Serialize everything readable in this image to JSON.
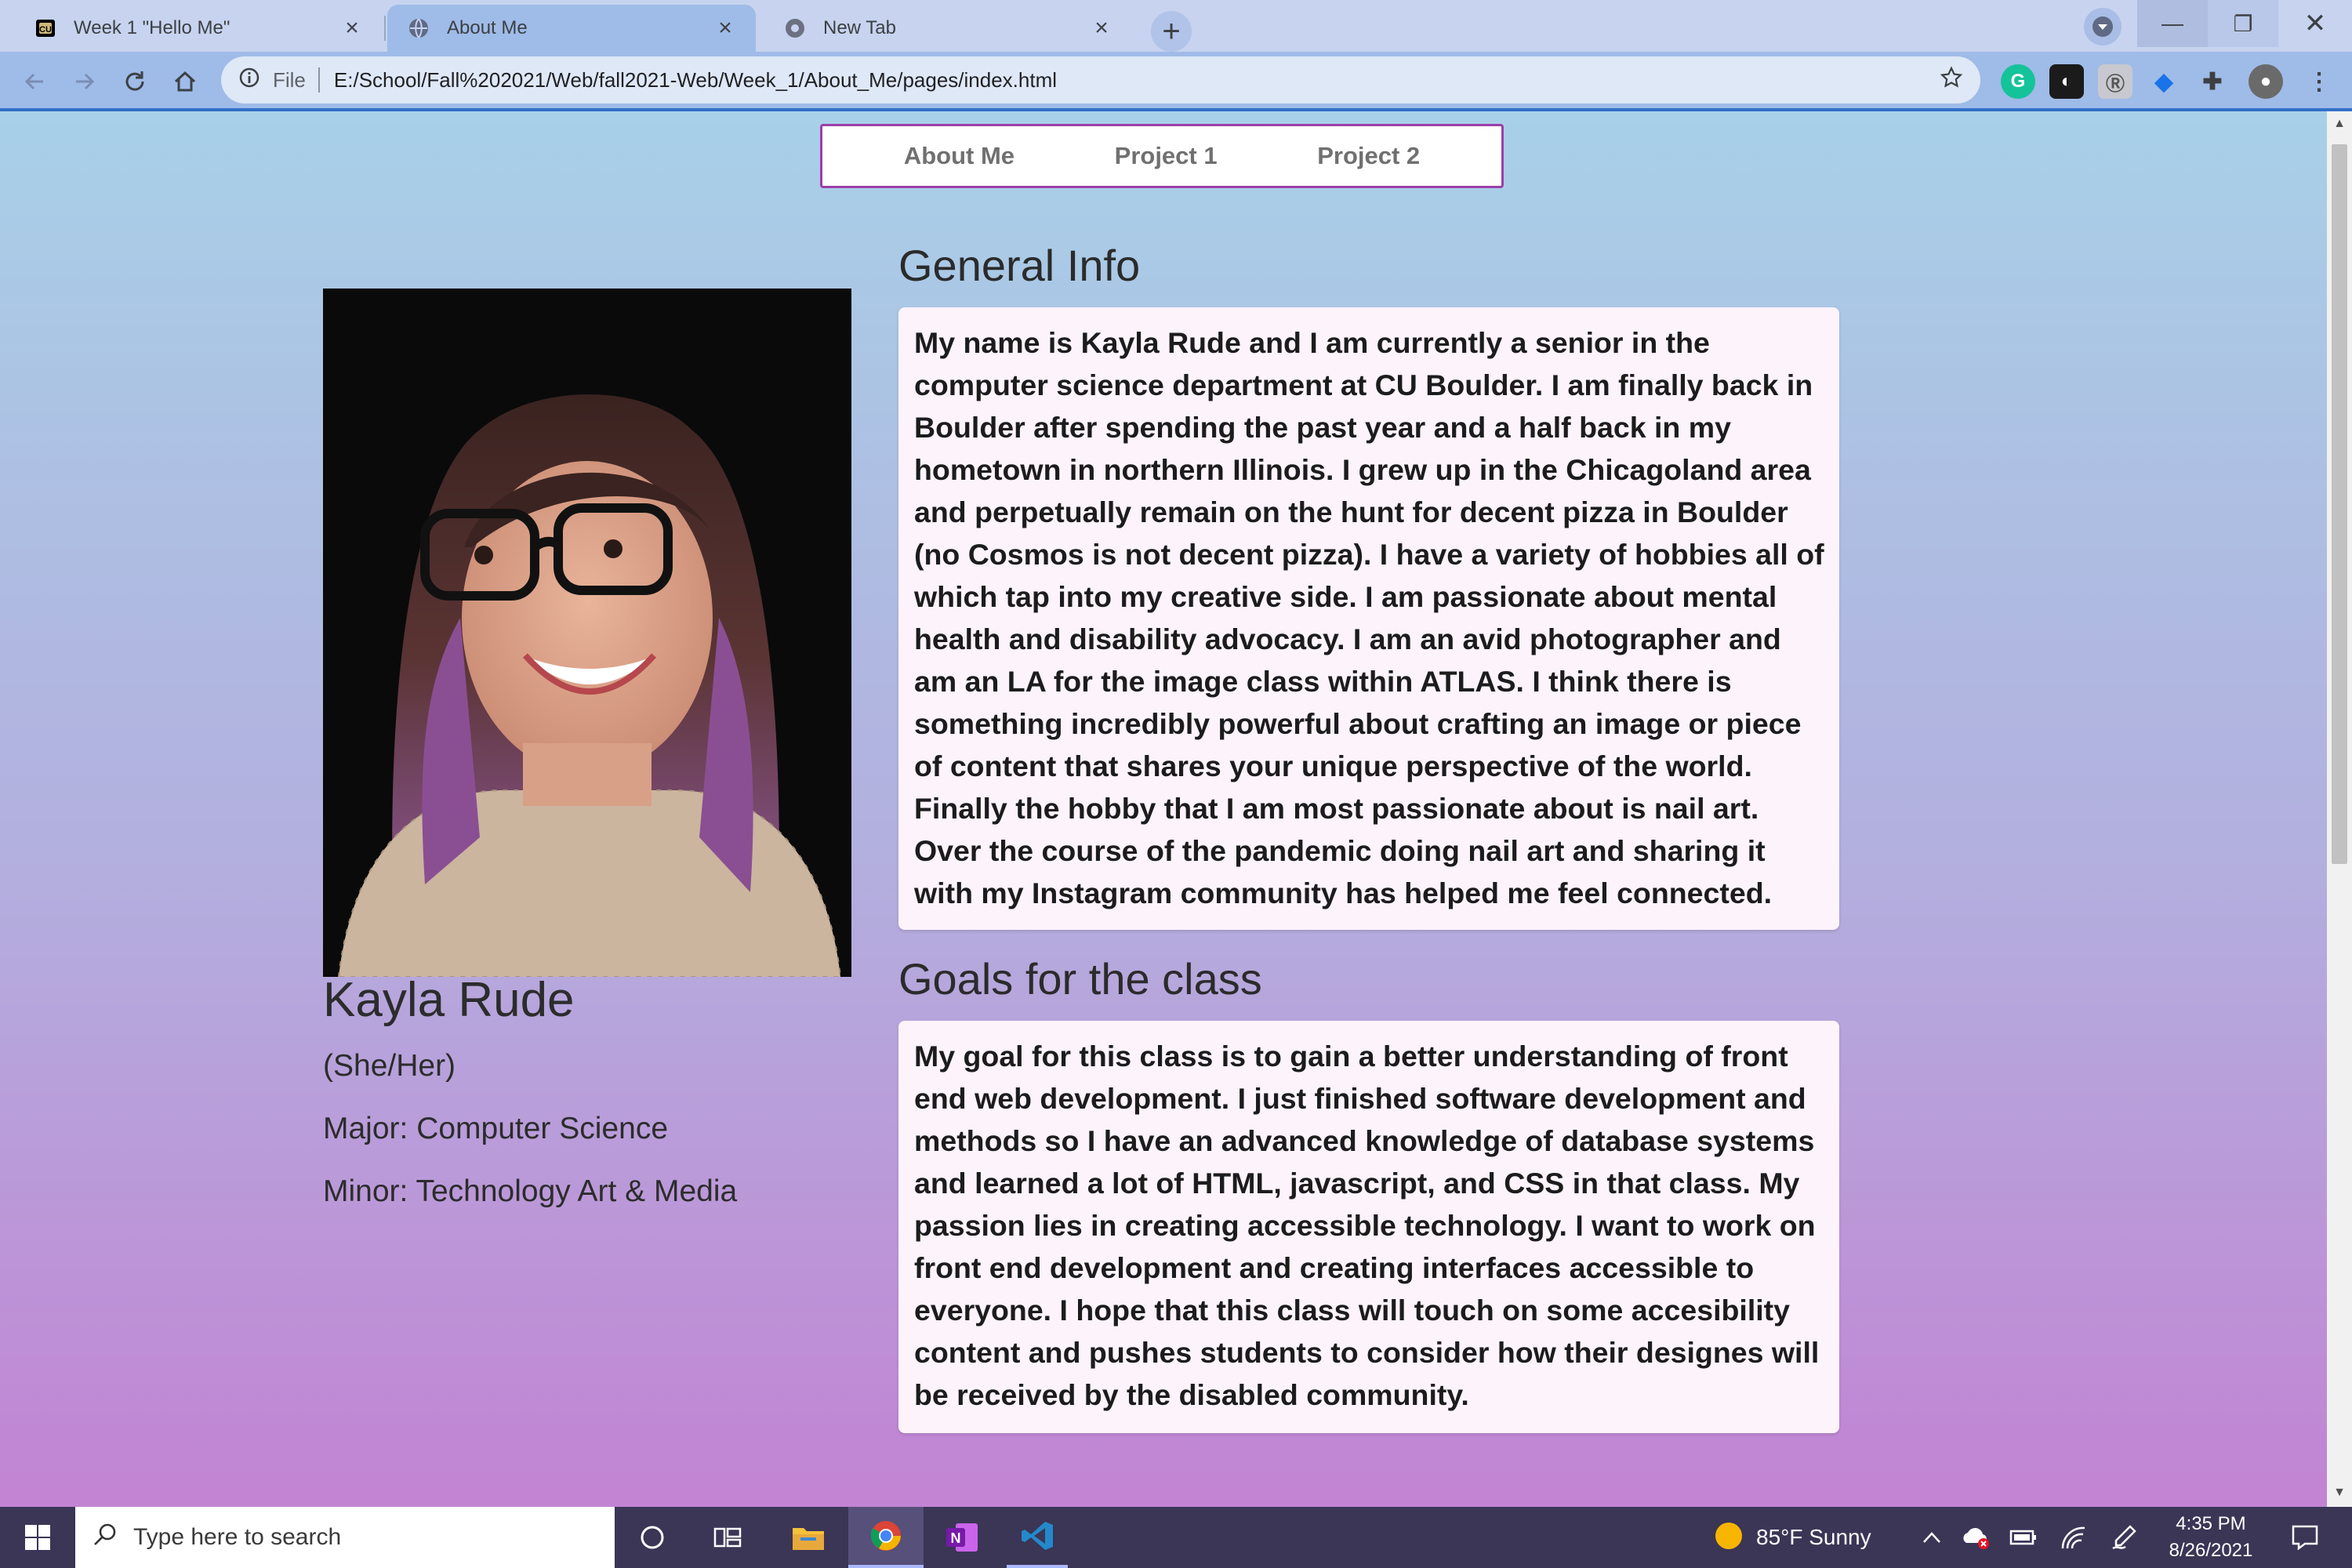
{
  "browser": {
    "tabs": [
      {
        "label": "Week 1 \"Hello Me\"",
        "icon": "cu-logo-icon",
        "active": false
      },
      {
        "label": "About Me",
        "icon": "globe-icon",
        "active": true
      },
      {
        "label": "New Tab",
        "icon": "chrome-icon",
        "active": false
      }
    ],
    "address": {
      "scheme_label": "File",
      "url": "E:/School/Fall%202021/Web/fall2021-Web/Week_1/About_Me/pages/index.html"
    },
    "accent": "#3470c8"
  },
  "page": {
    "nav": [
      "About Me",
      "Project 1",
      "Project 2"
    ],
    "profile": {
      "name": "Kayla Rude",
      "pronouns": "(She/Her)",
      "major": "Major: Computer Science",
      "minor": "Minor: Technology Art & Media"
    },
    "general": {
      "heading": "General Info",
      "body": "My name is Kayla Rude and I am currently a senior in the computer science department at CU Boulder. I am finally back in Boulder after spending the past year and a half back in my hometown in northern Illinois. I grew up in the Chicagoland area and perpetually remain on the hunt for decent pizza in Boulder (no Cosmos is not decent pizza). I have a variety of hobbies all of which tap into my creative side. I am passionate about mental health and disability advocacy. I am an avid photographer and am an LA for the image class within ATLAS. I think there is something incredibly powerful about crafting an image or piece of content that shares your unique perspective of the world. Finally the hobby that I am most passionate about is nail art. Over the course of the pandemic doing nail art and sharing it with my Instagram community has helped me feel connected."
    },
    "goals": {
      "heading": "Goals for the class",
      "body": "My goal for this class is to gain a better understanding of front end web development. I just finished software development and methods so I have an advanced knowledge of database systems and learned a lot of HTML, javascript, and CSS in that class. My passion lies in creating accessible technology. I want to work on front end development and creating interfaces accessible to everyone. I hope that this class will touch on some accesibility content and pushes students to consider how their designes will be received by the disabled community."
    },
    "colors": {
      "nav_border": "#9b3fa7",
      "gradient_top": "#a8d0e8",
      "gradient_bottom": "#c283d3"
    }
  },
  "taskbar": {
    "search_placeholder": "Type here to search",
    "weather": "85°F  Sunny",
    "time": "4:35 PM",
    "date": "8/26/2021"
  }
}
